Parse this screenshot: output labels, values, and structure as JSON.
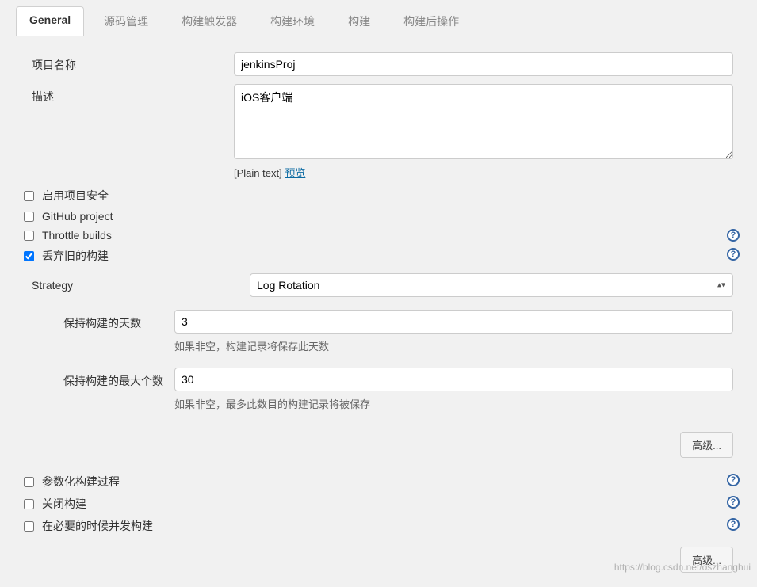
{
  "tabs": [
    {
      "label": "General",
      "active": true
    },
    {
      "label": "源码管理",
      "active": false
    },
    {
      "label": "构建触发器",
      "active": false
    },
    {
      "label": "构建环境",
      "active": false
    },
    {
      "label": "构建",
      "active": false
    },
    {
      "label": "构建后操作",
      "active": false
    }
  ],
  "form": {
    "project_name_label": "项目名称",
    "project_name_value": "jenkinsProj",
    "description_label": "描述",
    "description_value": "iOS客户端",
    "desc_format_prefix": "[Plain text] ",
    "desc_preview_link": "预览"
  },
  "checkboxes": {
    "enable_security": {
      "label": "启用项目安全",
      "checked": false,
      "help": false
    },
    "github_project": {
      "label": "GitHub project",
      "checked": false,
      "help": false
    },
    "throttle_builds": {
      "label": "Throttle builds",
      "checked": false,
      "help": true
    },
    "discard_old": {
      "label": "丢弃旧的构建",
      "checked": true,
      "help": true
    }
  },
  "strategy": {
    "label": "Strategy",
    "selected": "Log Rotation",
    "days_label": "保持构建的天数",
    "days_value": "3",
    "days_hint": "如果非空，构建记录将保存此天数",
    "max_label": "保持构建的最大个数",
    "max_value": "30",
    "max_hint": "如果非空，最多此数目的构建记录将被保存",
    "advanced_btn": "高级..."
  },
  "lower_checkboxes": {
    "parameterized": {
      "label": "参数化构建过程",
      "checked": false
    },
    "disable_build": {
      "label": "关闭构建",
      "checked": false
    },
    "concurrent": {
      "label": "在必要的时候并发构建",
      "checked": false
    }
  },
  "bottom_advanced_btn": "高级...",
  "watermark": "https://blog.csdn.net/oszhanghui"
}
